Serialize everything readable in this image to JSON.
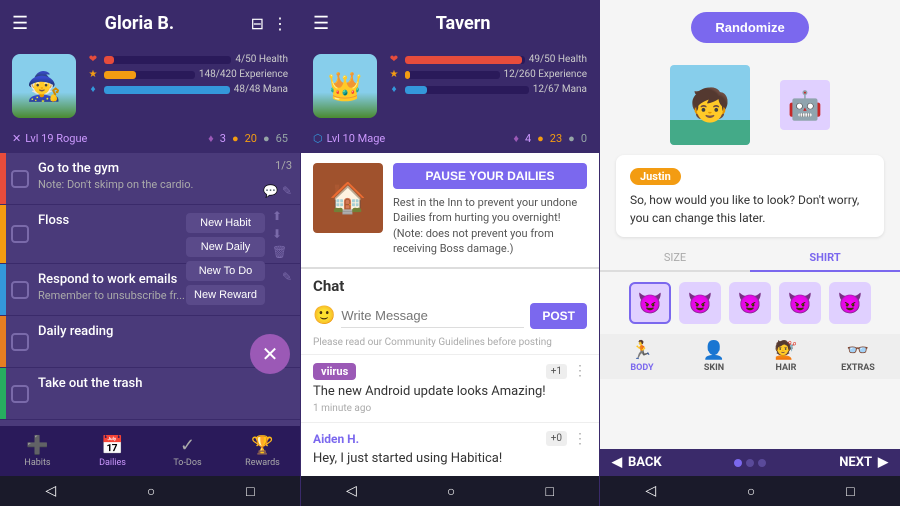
{
  "left": {
    "header": {
      "title": "Gloria B.",
      "menu_icon": "☰",
      "filter_icon": "⊟",
      "more_icon": "⋮"
    },
    "stats": {
      "health_current": "4",
      "health_max": "50",
      "health_label": "Health",
      "exp_current": "148",
      "exp_max": "420",
      "exp_label": "Experience",
      "mana_current": "48",
      "mana_max": "48",
      "mana_label": "Mana",
      "health_pct": 8,
      "exp_pct": 35,
      "mana_pct": 100
    },
    "level": {
      "label": "Lvl 19 Rogue",
      "gems": "3",
      "gold": "20",
      "silver": "65"
    },
    "tabs": [
      "Habits",
      "Dailies",
      "To-Dos",
      "Rewards"
    ],
    "active_tab": "Dailies",
    "tasks": [
      {
        "id": "gym",
        "title": "Go to the gym",
        "note": "Note: Don't skimp on the cardio.",
        "color": "#e74c3c",
        "count": "1/3",
        "show_popup": false
      },
      {
        "id": "floss",
        "title": "Floss",
        "note": "",
        "color": "#f39c12",
        "count": "",
        "show_popup": true
      },
      {
        "id": "emails",
        "title": "Respond to work emails",
        "note": "Remember to unsubscribe fr...",
        "color": "#3498db",
        "count": "",
        "show_popup": true
      },
      {
        "id": "reading",
        "title": "Daily reading",
        "note": "",
        "color": "#e67e22",
        "count": "",
        "show_popup": false
      },
      {
        "id": "trash",
        "title": "Take out the trash",
        "note": "",
        "color": "#27ae60",
        "count": "",
        "show_popup": false
      }
    ],
    "popup_items": [
      "New Habit",
      "New Daily",
      "New To Do",
      "New Reward"
    ],
    "fab_icon": "✕",
    "nav": {
      "habits_label": "Habits",
      "dailies_label": "Dailies",
      "todos_label": "To-Dos",
      "rewards_label": "Rewards"
    }
  },
  "mid": {
    "header": {
      "title": "Tavern",
      "menu_icon": "☰"
    },
    "stats": {
      "health_current": "49",
      "health_max": "50",
      "health_label": "Health",
      "exp_current": "12",
      "exp_max": "260",
      "exp_label": "Experience",
      "mana_current": "12",
      "mana_max": "67",
      "mana_label": "Mana",
      "health_pct": 98,
      "exp_pct": 5,
      "mana_pct": 18
    },
    "level": {
      "label": "Lvl 10 Mage",
      "gems": "4",
      "gold": "23",
      "silver": "0"
    },
    "inn": {
      "pause_button": "PAUSE YOUR DAILIES",
      "description": "Rest in the Inn to prevent your undone Dailies from hurting you overnight! (Note: does not prevent you from receiving Boss damage.)"
    },
    "chat": {
      "title": "Chat",
      "placeholder": "Write Message",
      "post_label": "POST",
      "guidelines": "Please read our Community Guidelines before posting"
    },
    "messages": [
      {
        "user": "viirus",
        "user_color": "#9b59b6",
        "text": "The new Android update looks Amazing!",
        "time": "1 minute ago",
        "plus": "+1"
      },
      {
        "user": "Aiden H.",
        "user_color": "#7b68ee",
        "text": "Hey, I just started using Habitica!",
        "time": "",
        "plus": "+0"
      }
    ]
  },
  "right": {
    "randomize_label": "Randomize",
    "speaker": "Justin",
    "speech": "So, how would you like to look? Don't worry, you can change this later.",
    "tabs": [
      "SIZE",
      "SHIRT"
    ],
    "active_tab": "SHIRT",
    "avatar_options": [
      "😈",
      "😈",
      "😈",
      "😈",
      "😈"
    ],
    "categories": [
      {
        "icon": "🏃",
        "label": "BODY"
      },
      {
        "icon": "👤",
        "label": "SKIN"
      },
      {
        "icon": "💇",
        "label": "HAIR"
      },
      {
        "icon": "👓",
        "label": "EXTRAS"
      }
    ],
    "active_category": "BODY",
    "back_label": "BACK",
    "next_label": "NEXT"
  }
}
